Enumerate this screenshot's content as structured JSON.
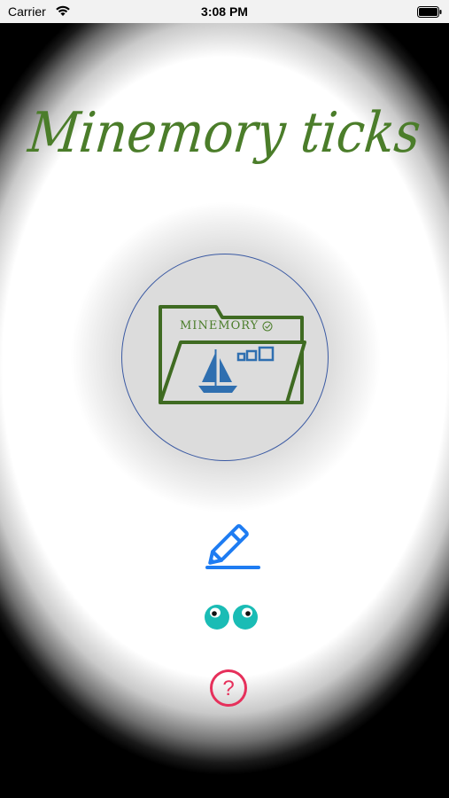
{
  "status_bar": {
    "carrier": "Carrier",
    "time": "3:08 PM",
    "icons": [
      "wifi-icon",
      "battery-icon"
    ]
  },
  "app": {
    "title": "Minemory ticks",
    "logo_text": "MINEMORY"
  },
  "actions": {
    "edit": {
      "icon": "pencil-icon",
      "color": "#1e7cf2"
    },
    "view": {
      "icon": "eyes-icon",
      "color": "#1abcb5"
    },
    "help": {
      "icon": "question-icon",
      "label": "?",
      "color": "#e6305b"
    }
  },
  "colors": {
    "title_green": "#4b7d2a",
    "logo_blue": "#2f6fb0",
    "circle_border": "#3b5aa3"
  }
}
